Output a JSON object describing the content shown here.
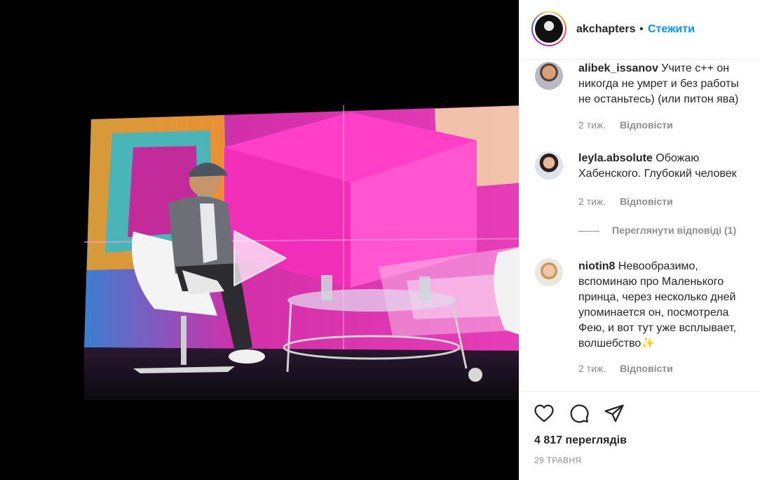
{
  "post": {
    "username": "akchapters",
    "separator": "•",
    "follow_label": "Стежити"
  },
  "comments": [
    {
      "user": "alibek_issanov",
      "text": "Учите с++ он никогда не умрет и без работы не останьтесь) (или питон ява)",
      "time": "2 тиж.",
      "reply_label": "Відповісти"
    },
    {
      "user": "leyla.absolute",
      "text": "Обожаю Хабенского. Глубокий человек",
      "time": "2 тиж.",
      "reply_label": "Відповісти"
    },
    {
      "user": "niotin8",
      "text": "Невообразимо, вспоминаю про Маленького принца, через несколько дней упоминается он, посмотрела Фею, и вот тут уже всплывает, волшебство✨",
      "time": "2 тиж.",
      "reply_label": "Відповісти"
    }
  ],
  "view_replies_label": "Переглянути відповіді (1)",
  "actions": {
    "icons": [
      "heart-icon",
      "comment-icon",
      "share-icon"
    ]
  },
  "views_label": "4 817 переглядів",
  "date_label": "29 ТРАВНЯ",
  "colors": {
    "link_blue": "#0095f6",
    "muted": "#8e8e8e",
    "text": "#262626"
  }
}
